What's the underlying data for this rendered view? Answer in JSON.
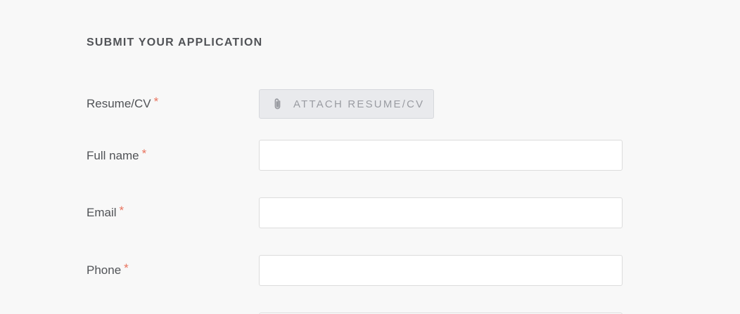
{
  "section_title": "SUBMIT YOUR APPLICATION",
  "required_marker": "*",
  "colors": {
    "background": "#f8f8f8",
    "text": "#515357",
    "required": "#e9735e",
    "attach_bg": "#e9eaed",
    "attach_text": "#9a9ca2"
  },
  "fields": {
    "resume": {
      "label": "Resume/CV",
      "button_label": "ATTACH RESUME/CV",
      "button_icon": "paperclip-icon"
    },
    "full_name": {
      "label": "Full name",
      "value": "",
      "placeholder": ""
    },
    "email": {
      "label": "Email",
      "value": "",
      "placeholder": ""
    },
    "phone": {
      "label": "Phone",
      "value": "",
      "placeholder": ""
    }
  }
}
